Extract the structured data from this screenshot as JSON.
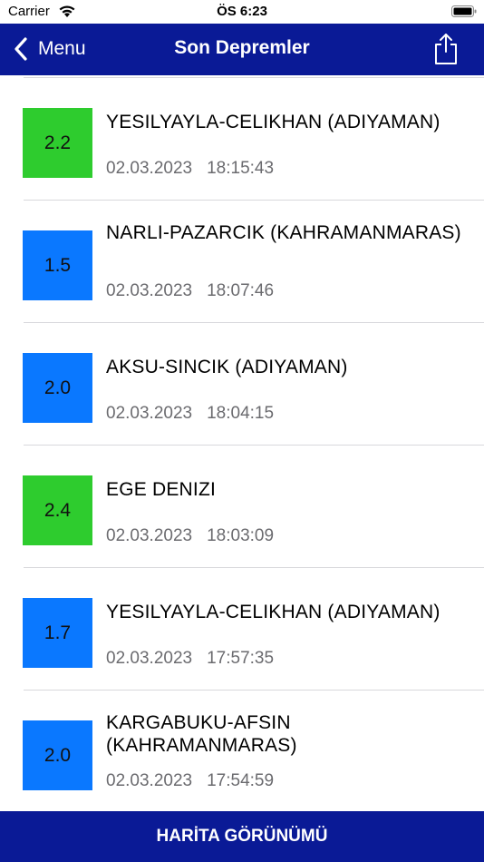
{
  "status_bar": {
    "carrier": "Carrier",
    "time": "ÖS 6:23"
  },
  "nav": {
    "back_label": "Menu",
    "title": "Son Depremler"
  },
  "colors": {
    "nav_bg": "#0a1a96",
    "mag_green": "#2ecc2e",
    "mag_blue": "#0a78ff"
  },
  "icons": {
    "back": "chevron-left-icon",
    "share": "share-icon",
    "wifi": "wifi-icon",
    "battery": "battery-icon"
  },
  "quakes": [
    {
      "magnitude": "2.2",
      "color": "#2ecc2e",
      "place": "YESILYAYLA-CELIKHAN (ADIYAMAN)",
      "date": "02.03.2023",
      "time": "18:15:43"
    },
    {
      "magnitude": "1.5",
      "color": "#0a78ff",
      "place": "NARLI-PAZARCIK (KAHRAMANMARAS)",
      "date": "02.03.2023",
      "time": "18:07:46"
    },
    {
      "magnitude": "2.0",
      "color": "#0a78ff",
      "place": "AKSU-SINCIK (ADIYAMAN)",
      "date": "02.03.2023",
      "time": "18:04:15"
    },
    {
      "magnitude": "2.4",
      "color": "#2ecc2e",
      "place": "EGE DENIZI",
      "date": "02.03.2023",
      "time": "18:03:09"
    },
    {
      "magnitude": "1.7",
      "color": "#0a78ff",
      "place": "YESILYAYLA-CELIKHAN (ADIYAMAN)",
      "date": "02.03.2023",
      "time": "17:57:35"
    },
    {
      "magnitude": "2.0",
      "color": "#0a78ff",
      "place": "KARGABUKU-AFSIN (KAHRAMANMARAS)",
      "date": "02.03.2023",
      "time": "17:54:59"
    }
  ],
  "bottom_button": {
    "label": "HARİTA GÖRÜNÜMÜ"
  }
}
